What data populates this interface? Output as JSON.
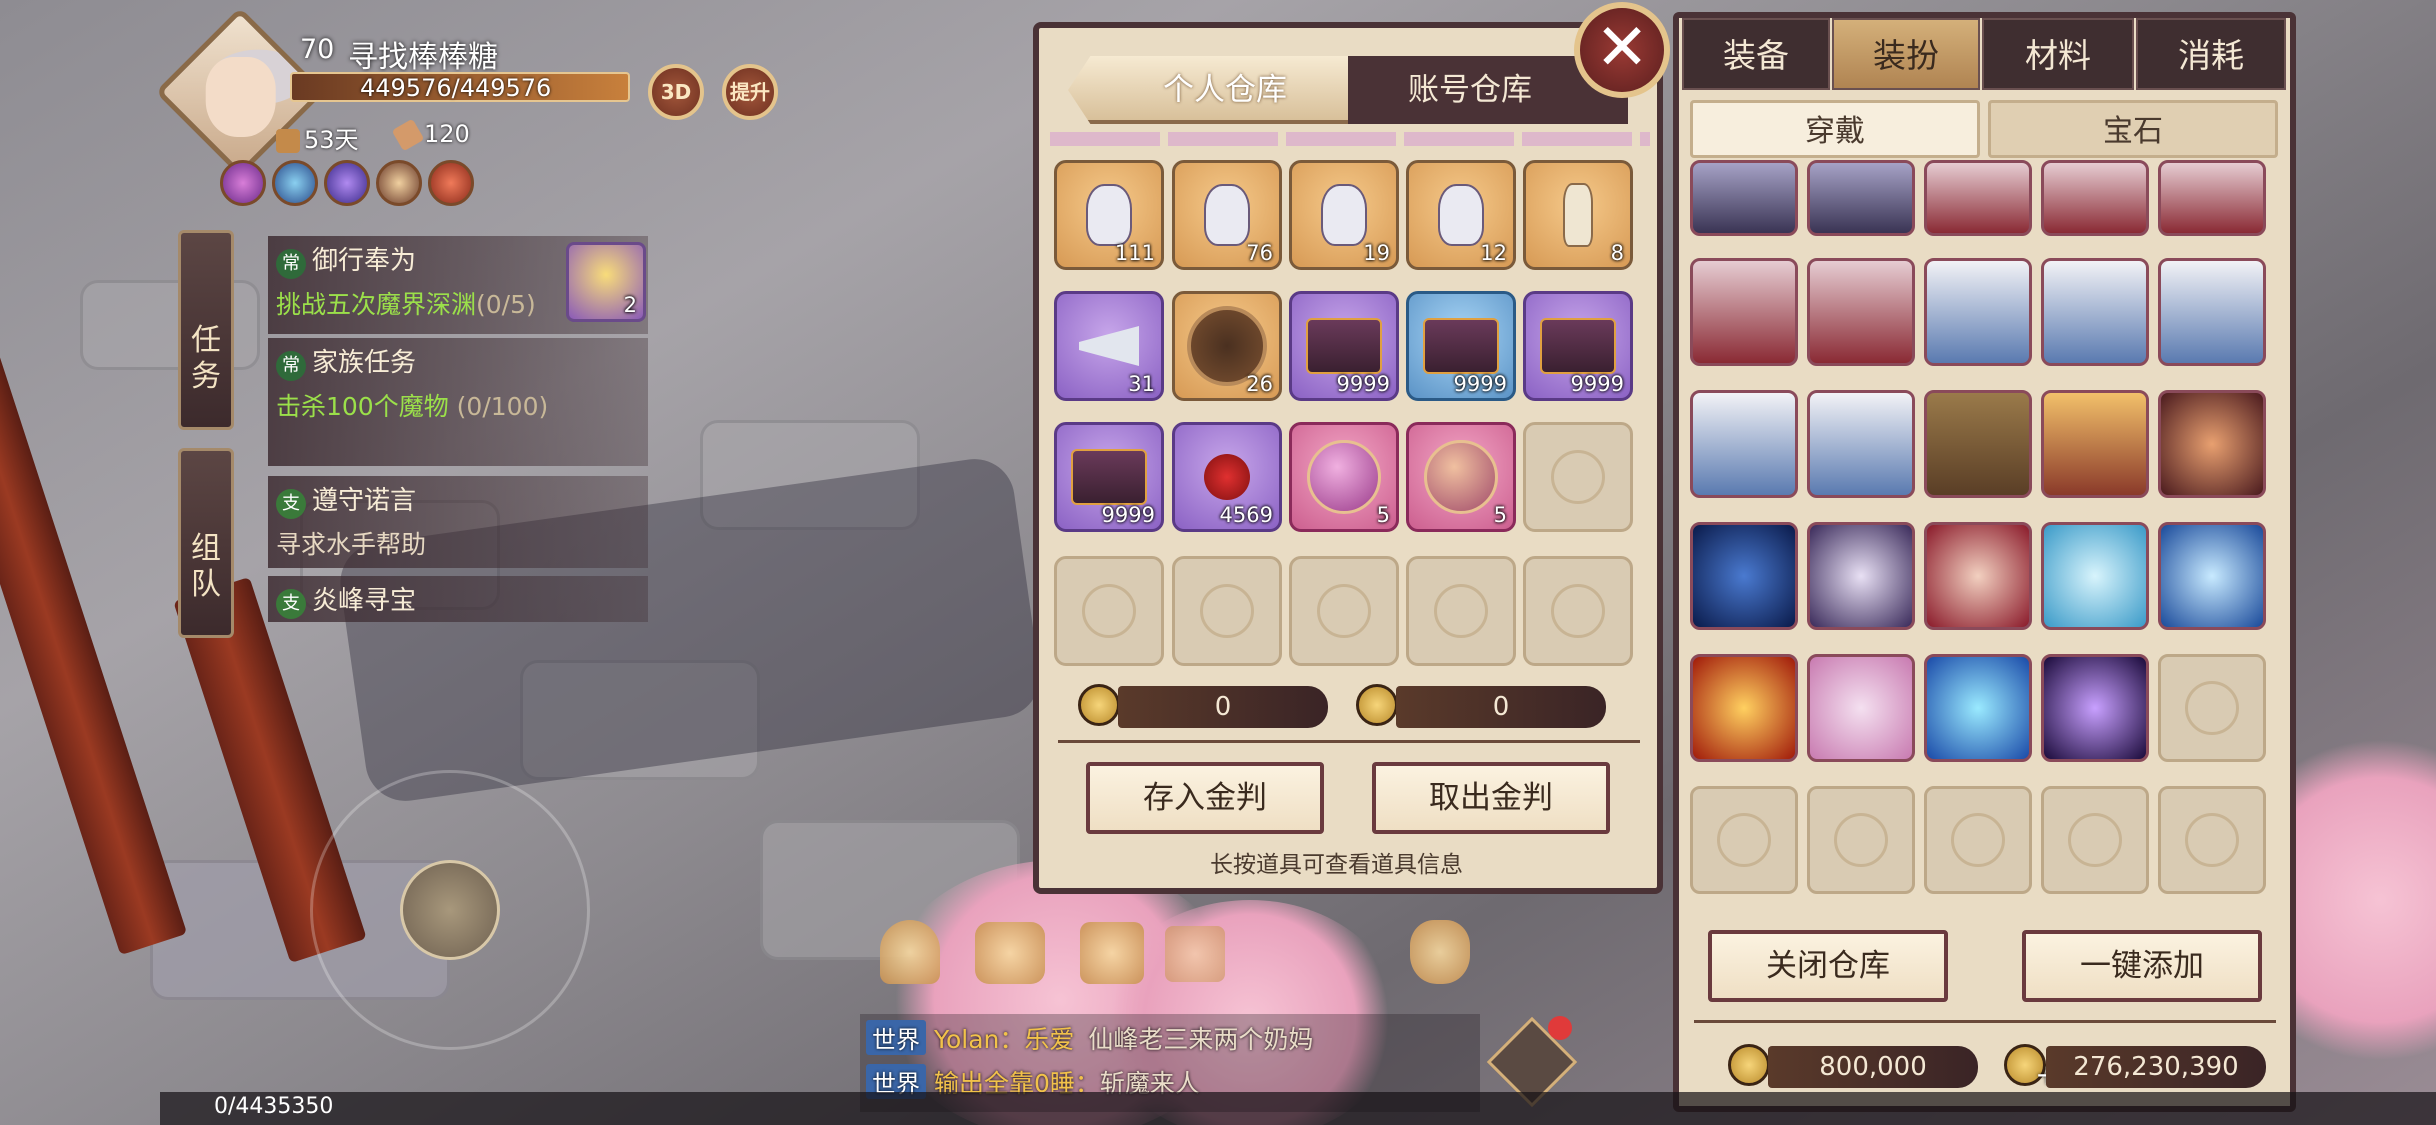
{
  "player": {
    "level": "70",
    "name": "寻找棒棒糖",
    "hp": "449576/449576",
    "days": "53天",
    "stamina": "120",
    "btn_3d": "3D",
    "btn_upgrade": "提升"
  },
  "quests": {
    "tab_task": "任务",
    "tab_team": "组队",
    "items": [
      {
        "tag": "常",
        "title": "御行奉为",
        "desc": "挑战五次魔界深渊",
        "progress": "(0/5)",
        "reward_count": "2"
      },
      {
        "tag": "常",
        "title": "家族任务",
        "desc": "击杀100个魔物",
        "progress": "(0/100)"
      },
      {
        "tag": "支",
        "title": "遵守诺言",
        "desc": "寻求水手帮助"
      },
      {
        "tag": "支",
        "title": "炎峰寻宝"
      }
    ]
  },
  "warehouse": {
    "tabs": [
      "个人仓库",
      "账号仓库"
    ],
    "active_tab": 0,
    "rows": [
      [
        {
          "k": "orange",
          "i": "jar",
          "q": "111"
        },
        {
          "k": "orange",
          "i": "jar",
          "q": "76"
        },
        {
          "k": "orange",
          "i": "jar",
          "q": "19"
        },
        {
          "k": "orange",
          "i": "jar",
          "q": "12"
        },
        {
          "k": "orange",
          "i": "bottle",
          "q": "8"
        }
      ],
      [
        {
          "k": "purple",
          "i": "horn",
          "q": "31"
        },
        {
          "k": "orange",
          "i": "bowl",
          "q": "26"
        },
        {
          "k": "purple",
          "i": "chest",
          "q": "9999"
        },
        {
          "k": "blue",
          "i": "chest",
          "q": "9999"
        },
        {
          "k": "purple",
          "i": "chest",
          "q": "9999"
        }
      ],
      [
        {
          "k": "purple",
          "i": "chest",
          "q": "9999"
        },
        {
          "k": "purple",
          "i": "rose",
          "q": "4569"
        },
        {
          "k": "pink",
          "i": "orb",
          "q": "5"
        },
        {
          "k": "pink",
          "i": "orb2",
          "q": "5"
        },
        {
          "k": "empty",
          "i": "",
          "q": ""
        }
      ],
      [
        {
          "k": "empty",
          "i": "",
          "q": ""
        },
        {
          "k": "empty",
          "i": "",
          "q": ""
        },
        {
          "k": "empty",
          "i": "",
          "q": ""
        },
        {
          "k": "empty",
          "i": "",
          "q": ""
        },
        {
          "k": "empty",
          "i": "",
          "q": ""
        }
      ]
    ],
    "gold_left": "0",
    "gold_right": "0",
    "deposit_btn": "存入金判",
    "withdraw_btn": "取出金判",
    "hint": "长按道具可查看道具信息"
  },
  "inventory": {
    "tabs": [
      "装备",
      "装扮",
      "材料",
      "消耗"
    ],
    "active_tab": 1,
    "subtabs": [
      "穿戴",
      "宝石"
    ],
    "active_subtab": 0,
    "rows": [
      [
        "robe-dark",
        "robe-dark",
        "robe-red",
        "robe-red",
        "robe-red"
      ],
      [
        "robe-red",
        "robe-red",
        "robe-white",
        "robe-white",
        "robe-white"
      ],
      [
        "robe-white",
        "robe-white",
        "robe-brown",
        "armor",
        "rune"
      ],
      [
        "moon",
        "lotus",
        "compass",
        "frost",
        "planet"
      ],
      [
        "sun",
        "star",
        "wave",
        "magic",
        "empty"
      ],
      [
        "empty",
        "empty",
        "empty",
        "empty",
        "empty"
      ]
    ],
    "close_btn": "关闭仓库",
    "add_btn": "一键添加",
    "gold_1": "800,000",
    "gold_2": "276,230,390"
  },
  "chat": [
    {
      "channel": "世界",
      "user": "Yolan",
      "sep": "：",
      "tag": "乐爱",
      "msg": "仙峰老三来两个奶妈"
    },
    {
      "channel": "世界",
      "user": "输出全靠0睡",
      "sep": "：",
      "tag": "",
      "msg": "斩魔来人"
    }
  ],
  "exp": "0/4435350",
  "colors": {
    "panel": "#e9dcc4",
    "frame": "#4a3236",
    "gold": "#d4b07a",
    "quest_green": "#9be04a"
  }
}
